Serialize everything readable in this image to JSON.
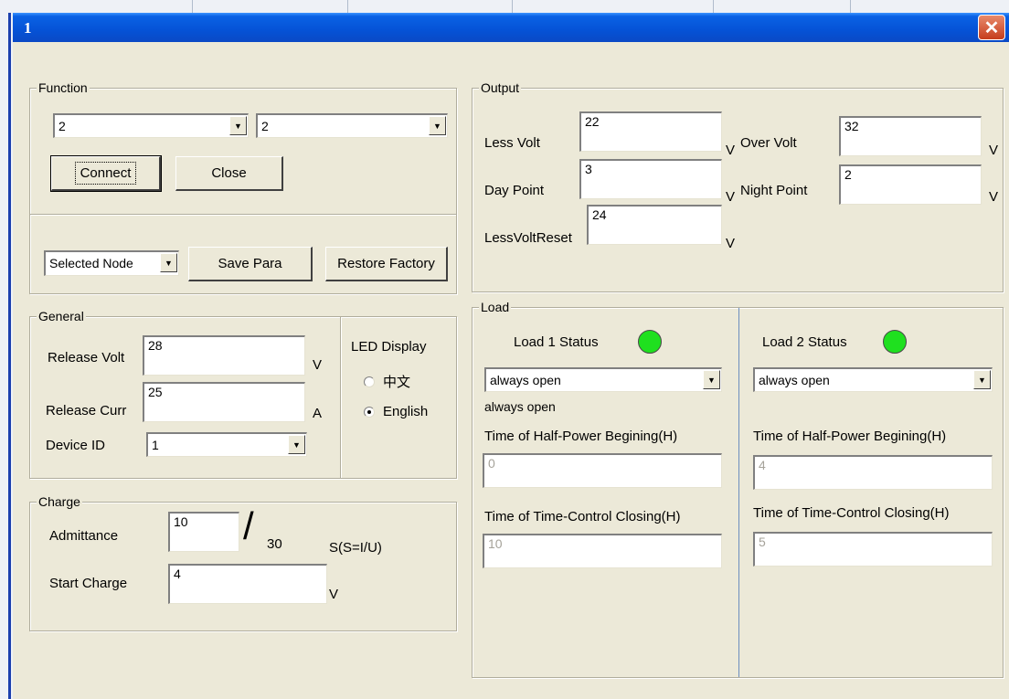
{
  "window": {
    "title": "1",
    "close_glyph": "✕"
  },
  "function": {
    "legend": "Function",
    "combo1_value": "2",
    "combo2_value": "2",
    "connect_label": "Connect",
    "close_label": "Close",
    "node_combo_value": "Selected Node",
    "save_label": "Save Para",
    "restore_label": "Restore Factory"
  },
  "general": {
    "legend": "General",
    "release_volt_label": "Release Volt",
    "release_volt_value": "28",
    "release_volt_unit": "V",
    "release_curr_label": "Release Curr",
    "release_curr_value": "25",
    "release_curr_unit": "A",
    "device_id_label": "Device ID",
    "device_id_value": "1",
    "led_label": "LED Display",
    "radio_chinese": "中文",
    "radio_english": "English",
    "selected_radio": "English"
  },
  "charge": {
    "legend": "Charge",
    "admittance_label": "Admittance",
    "admittance_value": "10",
    "slash": "/",
    "admittance_max": "30",
    "admittance_unit": "S(S=I/U)",
    "start_charge_label": "Start Charge",
    "start_charge_value": "4",
    "start_charge_unit": "V"
  },
  "output": {
    "legend": "Output",
    "less_volt_label": "Less Volt",
    "less_volt_value": "22",
    "over_volt_label": "Over Volt",
    "over_volt_value": "32",
    "day_point_label": "Day Point",
    "day_point_value": "3",
    "night_point_label": "Night Point",
    "night_point_value": "2",
    "less_volt_reset_label": "LessVoltReset",
    "less_volt_reset_value": "24",
    "unit": "V"
  },
  "load": {
    "legend": "Load",
    "load1": {
      "status_label": "Load 1 Status",
      "status_color": "#1fe01f",
      "mode_value": "always open",
      "mode_caption": "always open",
      "half_power_label": "Time of Half-Power Begining(H)",
      "half_power_value": "0",
      "time_control_label": "Time of Time-Control Closing(H)",
      "time_control_value": "10"
    },
    "load2": {
      "status_label": "Load 2 Status",
      "status_color": "#1fe01f",
      "mode_value": "always open",
      "half_power_label": "Time of Half-Power Begining(H)",
      "half_power_value": "4",
      "time_control_label": "Time of Time-Control Closing(H)",
      "time_control_value": "5"
    }
  }
}
